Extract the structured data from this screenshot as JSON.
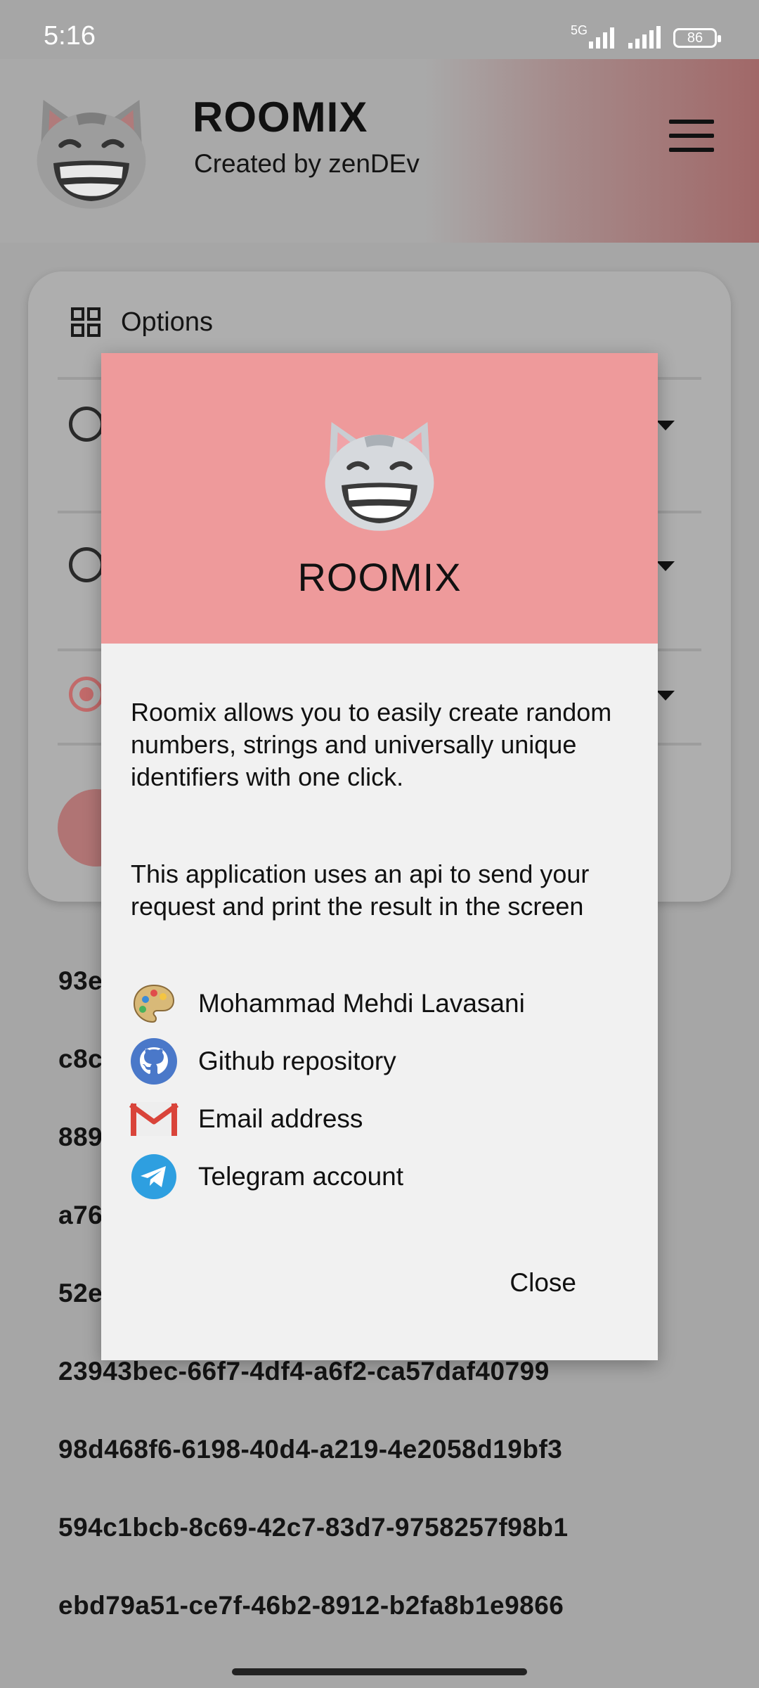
{
  "status_bar": {
    "time": "5:16",
    "network": "5G",
    "battery": "86",
    "icons": [
      "signal-5g-icon",
      "signal-icon",
      "battery-icon"
    ]
  },
  "header": {
    "title": "ROOMIX",
    "subtitle": "Created by zenDEv",
    "logo_icon": "grinning-cat-icon",
    "menu_icon": "hamburger-menu-icon"
  },
  "options": {
    "label": "Options",
    "icon": "grid-icon"
  },
  "results": [
    "93e",
    "c8c",
    "889",
    "a76",
    "52e",
    "23943bec-66f7-4df4-a6f2-ca57daf40799",
    "98d468f6-6198-40d4-a219-4e2058d19bf3",
    "594c1bcb-8c69-42c7-83d7-9758257f98b1",
    "ebd79a51-ce7f-46b2-8912-b2fa8b1e9866"
  ],
  "dialog": {
    "title": "ROOMIX",
    "paragraph1": "Roomix allows you to easily create random numbers, strings and universally unique identifiers with one click.",
    "paragraph2": "This application uses an api to send your request and print the result in the screen",
    "links": [
      {
        "icon": "palette-icon",
        "label": "Mohammad Mehdi Lavasani"
      },
      {
        "icon": "github-icon",
        "label": "Github repository"
      },
      {
        "icon": "gmail-icon",
        "label": "Email address"
      },
      {
        "icon": "telegram-icon",
        "label": "Telegram account"
      }
    ],
    "close_label": "Close"
  },
  "colors": {
    "accent": "#ee9a9b",
    "radio_selected": "#c26a6a",
    "scrim": "#a6a6a6"
  }
}
